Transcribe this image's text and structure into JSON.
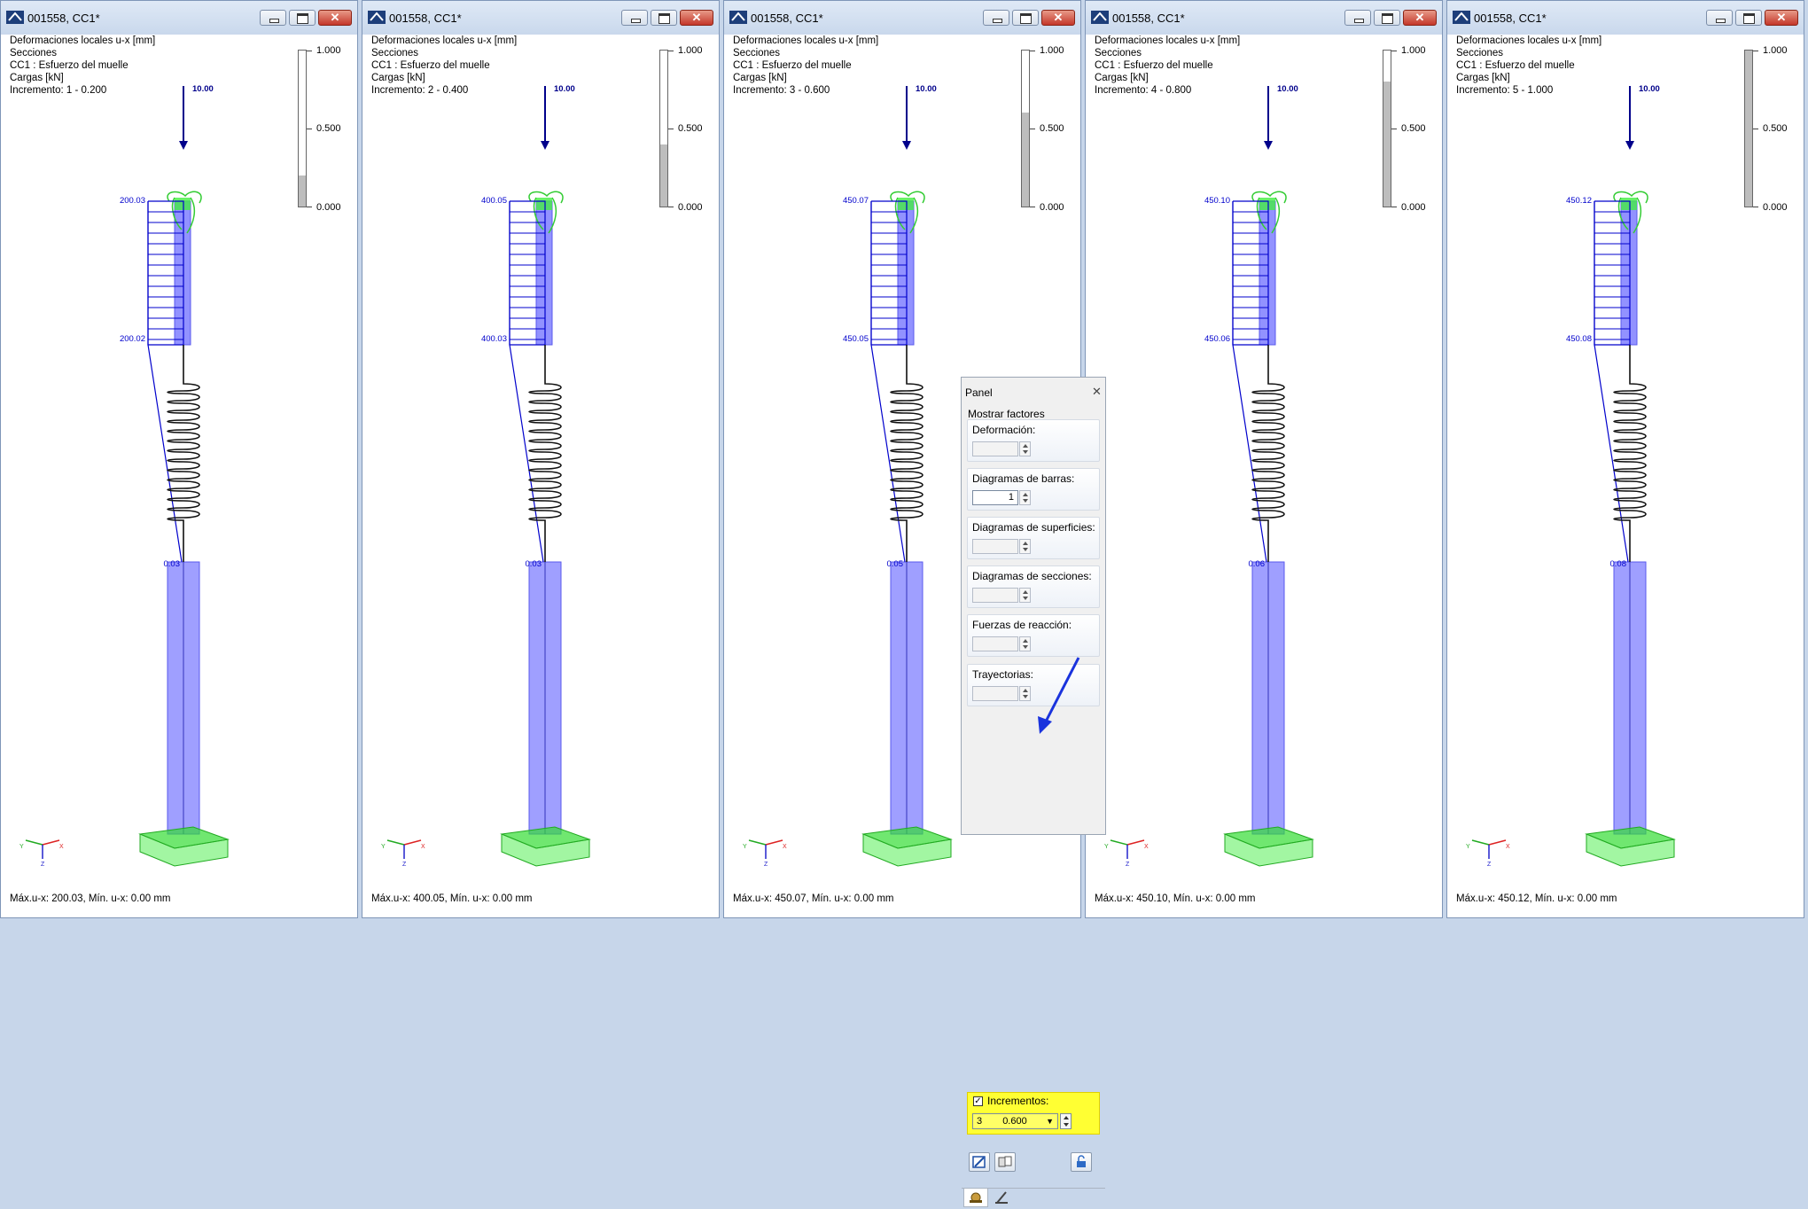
{
  "windows": [
    {
      "title": "001558, CC1*",
      "info": [
        "Deformaciones locales u-x [mm]",
        "Secciones",
        "CC1 : Esfuerzo del muelle",
        "Cargas [kN]",
        "Incremento: 1 - 0.200"
      ],
      "load_label": "10.00",
      "top_label": "200.03",
      "mid_label": "200.02",
      "base_label": "0.03",
      "scale_fill": 0.2,
      "footer": "Máx.u-x: 200.03, Mín. u-x: 0.00 mm"
    },
    {
      "title": "001558, CC1*",
      "info": [
        "Deformaciones locales u-x [mm]",
        "Secciones",
        "CC1 : Esfuerzo del muelle",
        "Cargas [kN]",
        "Incremento: 2 - 0.400"
      ],
      "load_label": "10.00",
      "top_label": "400.05",
      "mid_label": "400.03",
      "base_label": "0.03",
      "scale_fill": 0.4,
      "footer": "Máx.u-x: 400.05, Mín. u-x: 0.00 mm"
    },
    {
      "title": "001558, CC1*",
      "info": [
        "Deformaciones locales u-x [mm]",
        "Secciones",
        "CC1 : Esfuerzo del muelle",
        "Cargas [kN]",
        "Incremento: 3 - 0.600"
      ],
      "load_label": "10.00",
      "top_label": "450.07",
      "mid_label": "450.05",
      "base_label": "0.05",
      "scale_fill": 0.6,
      "footer": "Máx.u-x: 450.07, Mín. u-x: 0.00 mm"
    },
    {
      "title": "001558, CC1*",
      "info": [
        "Deformaciones locales u-x [mm]",
        "Secciones",
        "CC1 : Esfuerzo del muelle",
        "Cargas [kN]",
        "Incremento: 4 - 0.800"
      ],
      "load_label": "10.00",
      "top_label": "450.10",
      "mid_label": "450.06",
      "base_label": "0.06",
      "scale_fill": 0.8,
      "footer": "Máx.u-x: 450.10, Mín. u-x: 0.00 mm"
    },
    {
      "title": "001558, CC1*",
      "info": [
        "Deformaciones locales u-x [mm]",
        "Secciones",
        "CC1 : Esfuerzo del muelle",
        "Cargas [kN]",
        "Incremento: 5 - 1.000"
      ],
      "load_label": "10.00",
      "top_label": "450.12",
      "mid_label": "450.08",
      "base_label": "0.08",
      "scale_fill": 1.0,
      "footer": "Máx.u-x: 450.12, Mín. u-x: 0.00 mm"
    }
  ],
  "scale": {
    "top": "1.000",
    "mid": "0.500",
    "bottom": "0.000"
  },
  "axes": {
    "x": "X",
    "y": "Y",
    "z": "Z"
  },
  "panel": {
    "title": "Panel",
    "subtitle": "Mostrar factores",
    "groups": [
      {
        "label": "Deformación:",
        "value": "",
        "enabled": false
      },
      {
        "label": "Diagramas de barras:",
        "value": "1",
        "enabled": true
      },
      {
        "label": "Diagramas de superficies:",
        "value": "",
        "enabled": false
      },
      {
        "label": "Diagramas de secciones:",
        "value": "",
        "enabled": false
      },
      {
        "label": "Fuerzas de reacción:",
        "value": "",
        "enabled": false
      },
      {
        "label": "Trayectorias:",
        "value": "",
        "enabled": false
      }
    ],
    "increments": {
      "label": "Incrementos:",
      "checked": true,
      "number": "3",
      "value": "0.600"
    }
  },
  "colors": {
    "diagram": "#0000cc",
    "member": "#7f7fff",
    "support": "#33dd33",
    "highlight": "#ffff33",
    "annotation_arrow": "#1a33dd"
  }
}
